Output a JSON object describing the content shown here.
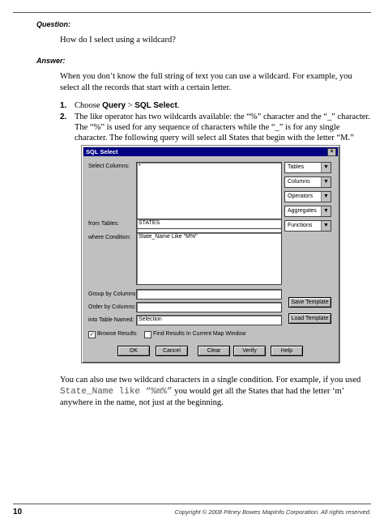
{
  "question": {
    "label": "Question:",
    "text": "How do I select using a wildcard?"
  },
  "answer": {
    "label": "Answer:",
    "intro": "When you don’t know the full string of text you can use a wildcard. For example, you select all the records that start with a certain letter."
  },
  "steps": [
    {
      "num": "1.",
      "pre": "Choose ",
      "bold1": "Query",
      "sep": " > ",
      "bold2": "SQL Select",
      "post": "."
    },
    {
      "num": "2.",
      "text": "The like operator has two wildcards available: the “%” character and the “_” character. The “%” is used for any sequence of characters while the “_” is for any single character. The following query will select all States that begin with the letter “M.”"
    }
  ],
  "dialog": {
    "title": "SQL Select",
    "close": "×",
    "select_columns_label": "Select Columns:",
    "select_columns_value": "*",
    "from_tables_label": "from Tables:",
    "from_tables_value": "STATES",
    "where_label": "where Condition:",
    "where_value": "State_Name Like \"M%\"",
    "group_label": "Group by Columns:",
    "group_value": "",
    "order_label": "Order by Columns:",
    "order_value": "",
    "into_label": "into Table Named:",
    "into_value": "Selection",
    "dropdowns": [
      "Tables",
      "Columns",
      "Operators",
      "Aggregates",
      "Functions"
    ],
    "save_template": "Save Template",
    "load_template": "Load Template",
    "browse_results": "Browse Results",
    "find_results": "Find Results In Current Map Window",
    "buttons": [
      "OK",
      "Cancel",
      "Clear",
      "Verify",
      "Help"
    ]
  },
  "closing": {
    "pre": "You can also use two wildcard characters in a single condition. For example, if you used",
    "code": "State_Name like “%m%”",
    "post": " you would get all the States that had the letter ‘m’ anywhere in the name, not just at the beginning."
  },
  "footer": {
    "page": "10",
    "copyright": "Copyright © 2008 Pitney Bowes MapInfo Corporation. All rights reserved."
  }
}
